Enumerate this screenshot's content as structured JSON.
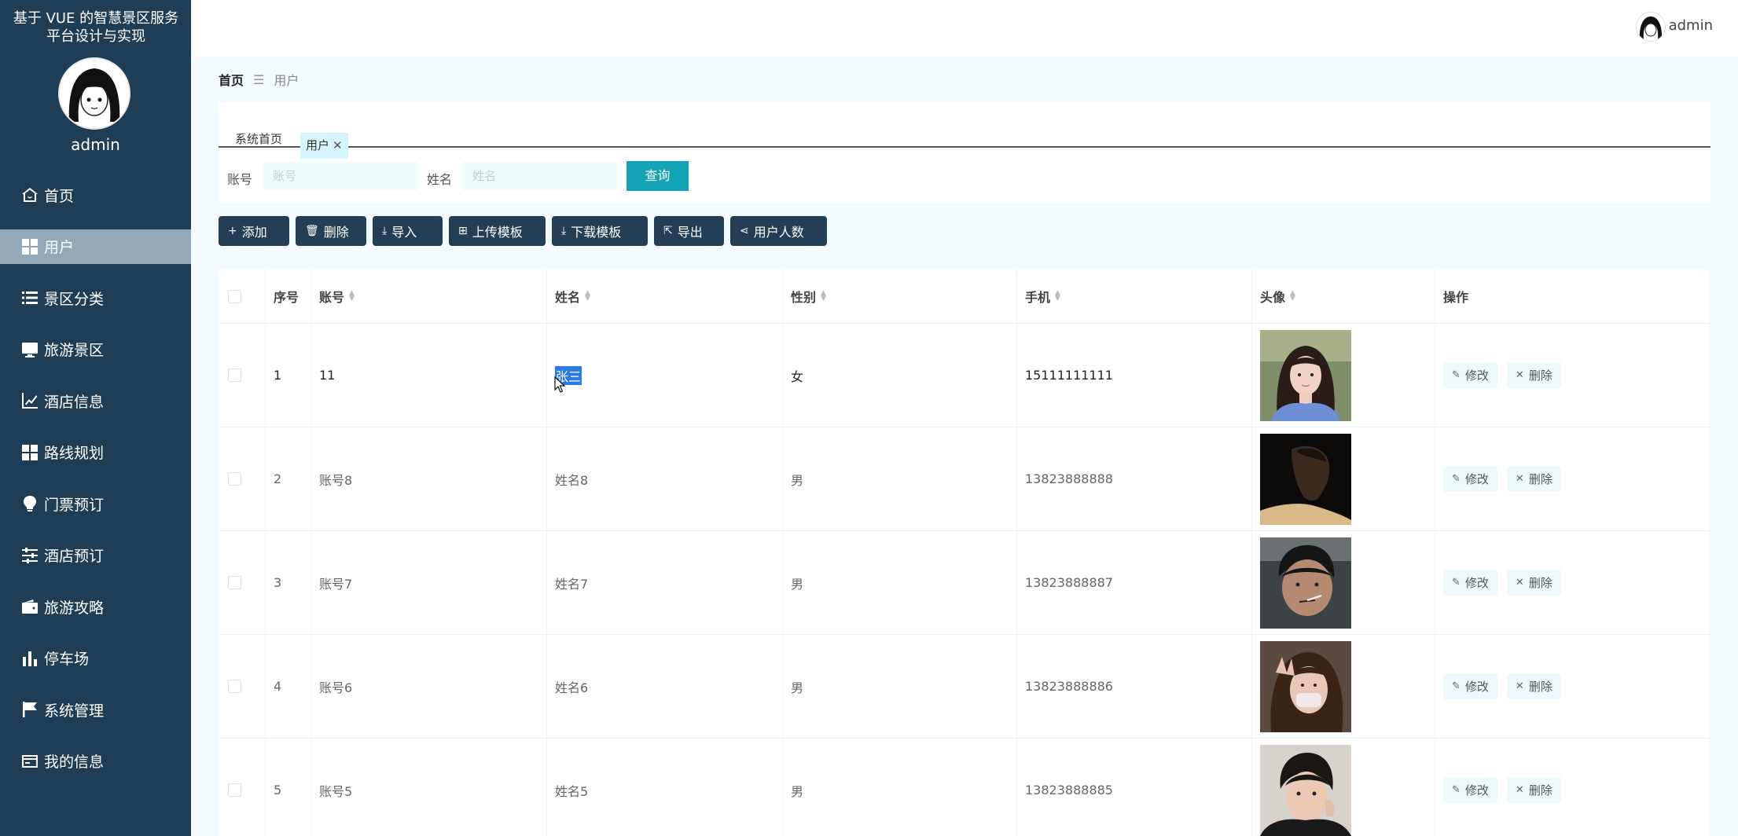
{
  "app": {
    "title": "基于 VUE 的智慧景区服务平台设计与实现",
    "sidebar_user": "admin"
  },
  "menu": [
    {
      "label": "首页",
      "icon": "home-icon"
    },
    {
      "label": "用户",
      "icon": "grid-icon",
      "active": true
    },
    {
      "label": "景区分类",
      "icon": "list-icon"
    },
    {
      "label": "旅游景区",
      "icon": "monitor-icon"
    },
    {
      "label": "酒店信息",
      "icon": "chart-line-icon"
    },
    {
      "label": "路线规划",
      "icon": "grid-icon"
    },
    {
      "label": "门票预订",
      "icon": "bulb-icon"
    },
    {
      "label": "酒店预订",
      "icon": "sliders-icon"
    },
    {
      "label": "旅游攻略",
      "icon": "wallet-icon"
    },
    {
      "label": "停车场",
      "icon": "bar-chart-icon"
    },
    {
      "label": "系统管理",
      "icon": "flag-icon"
    },
    {
      "label": "我的信息",
      "icon": "card-icon"
    }
  ],
  "topbar": {
    "user": "admin"
  },
  "breadcrumb": {
    "home": "首页",
    "sep": "☰",
    "current": "用户"
  },
  "tabs": [
    {
      "label": "系统首页"
    },
    {
      "label": "用户",
      "close": "✕"
    }
  ],
  "search": {
    "account_label": "账号",
    "account_placeholder": "账号",
    "account_value": "",
    "name_label": "姓名",
    "name_placeholder": "姓名",
    "name_value": "",
    "query_label": "查询"
  },
  "toolbar": [
    {
      "label": "添加",
      "icon": "plus-icon",
      "glyph": "+"
    },
    {
      "label": "删除",
      "icon": "trash-icon",
      "glyph": "🗑"
    },
    {
      "label": "导入",
      "icon": "import-icon",
      "glyph": "⤓"
    },
    {
      "label": "上传模板",
      "icon": "folder-upload-icon",
      "glyph": "⊞"
    },
    {
      "label": "下载模板",
      "icon": "download-icon",
      "glyph": "⤓"
    },
    {
      "label": "导出",
      "icon": "export-icon",
      "glyph": "⇱"
    },
    {
      "label": "用户人数",
      "icon": "share-icon",
      "glyph": "⋖"
    }
  ],
  "table": {
    "columns": [
      "序号",
      "账号",
      "姓名",
      "性别",
      "手机",
      "头像",
      "操作"
    ],
    "rows": [
      {
        "no": "1",
        "account": "11",
        "name": "张三",
        "gender": "女",
        "phone": "15111111111",
        "avatar": "photo-female-1"
      },
      {
        "no": "2",
        "account": "账号8",
        "name": "姓名8",
        "gender": "男",
        "phone": "13823888888",
        "avatar": "photo-male-1"
      },
      {
        "no": "3",
        "account": "账号7",
        "name": "姓名7",
        "gender": "男",
        "phone": "13823888887",
        "avatar": "photo-male-2"
      },
      {
        "no": "4",
        "account": "账号6",
        "name": "姓名6",
        "gender": "男",
        "phone": "13823888886",
        "avatar": "photo-female-2"
      },
      {
        "no": "5",
        "account": "账号5",
        "name": "姓名5",
        "gender": "男",
        "phone": "13823888885",
        "avatar": "photo-male-3"
      }
    ],
    "edit_label": "修改",
    "delete_label": "删除"
  },
  "colors": {
    "sidebar": "#1f3e55",
    "active_menu": "#93a8b8",
    "query_button": "#12a4b5",
    "toolbar_button": "#243f55",
    "selection": "#2d7be5"
  }
}
